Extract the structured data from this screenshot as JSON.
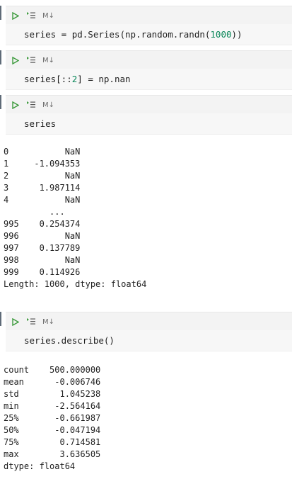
{
  "cells": [
    {
      "md_label": "M↓",
      "code_prefix": "series = pd.Series(np.random.randn(",
      "code_number": "1000",
      "code_suffix": "))"
    },
    {
      "md_label": "M↓",
      "code_prefix": "series[::",
      "code_number": "2",
      "code_suffix": "] = np.nan"
    },
    {
      "md_label": "M↓",
      "code_prefix": "series",
      "code_number": "",
      "code_suffix": "",
      "output": [
        "0           NaN",
        "1     -1.094353",
        "2           NaN",
        "3      1.987114",
        "4           NaN",
        "         ...",
        "995    0.254374",
        "996         NaN",
        "997    0.137789",
        "998         NaN",
        "999    0.114926",
        "Length: 1000, dtype: float64"
      ]
    },
    {
      "md_label": "M↓",
      "code_prefix": "series.describe()",
      "code_number": "",
      "code_suffix": "",
      "output": [
        "count    500.000000",
        "mean      -0.006746",
        "std        1.045238",
        "min       -2.564164",
        "25%       -0.661987",
        "50%       -0.047194",
        "75%        0.714581",
        "max        3.636505",
        "dtype: float64"
      ]
    }
  ],
  "colors": {
    "run_icon": "#3c9a3c",
    "number_literal": "#098658",
    "toolbar_bg": "#f3f3f3"
  },
  "icons": {
    "run": "play-icon",
    "run_below": "run-below-icon",
    "markdown": "markdown-icon"
  }
}
